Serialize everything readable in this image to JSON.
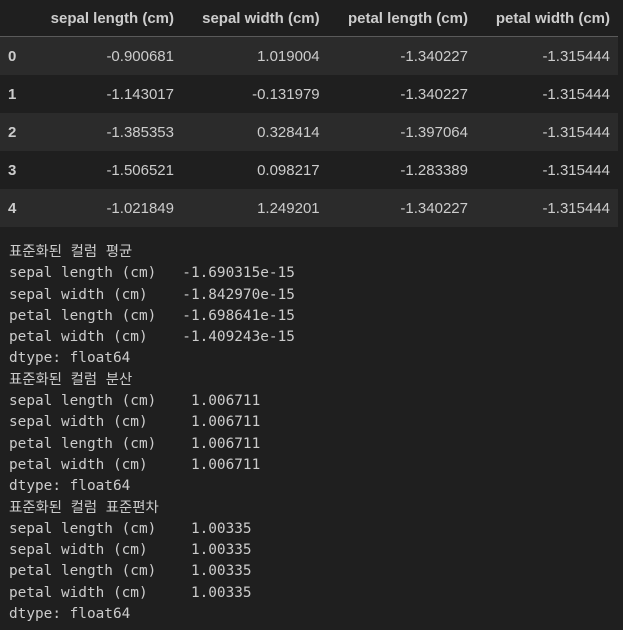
{
  "dataframe": {
    "columns": [
      "",
      "sepal length (cm)",
      "sepal width (cm)",
      "petal length (cm)",
      "petal width (cm)"
    ],
    "rows": [
      [
        "0",
        "-0.900681",
        "1.019004",
        "-1.340227",
        "-1.315444"
      ],
      [
        "1",
        "-1.143017",
        "-0.131979",
        "-1.340227",
        "-1.315444"
      ],
      [
        "2",
        "-1.385353",
        "0.328414",
        "-1.397064",
        "-1.315444"
      ],
      [
        "3",
        "-1.506521",
        "0.098217",
        "-1.283389",
        "-1.315444"
      ],
      [
        "4",
        "-1.021849",
        "1.249201",
        "-1.340227",
        "-1.315444"
      ]
    ]
  },
  "stdout_lines": [
    "표준화된 컬럼 평균",
    "sepal length (cm)   -1.690315e-15",
    "sepal width (cm)    -1.842970e-15",
    "petal length (cm)   -1.698641e-15",
    "petal width (cm)    -1.409243e-15",
    "dtype: float64",
    "표준화된 컬럼 분산",
    "sepal length (cm)    1.006711",
    "sepal width (cm)     1.006711",
    "petal length (cm)    1.006711",
    "petal width (cm)     1.006711",
    "dtype: float64",
    "표준화된 컬럼 표준편차",
    "sepal length (cm)    1.00335",
    "sepal width (cm)     1.00335",
    "petal length (cm)    1.00335",
    "petal width (cm)     1.00335",
    "dtype: float64"
  ]
}
